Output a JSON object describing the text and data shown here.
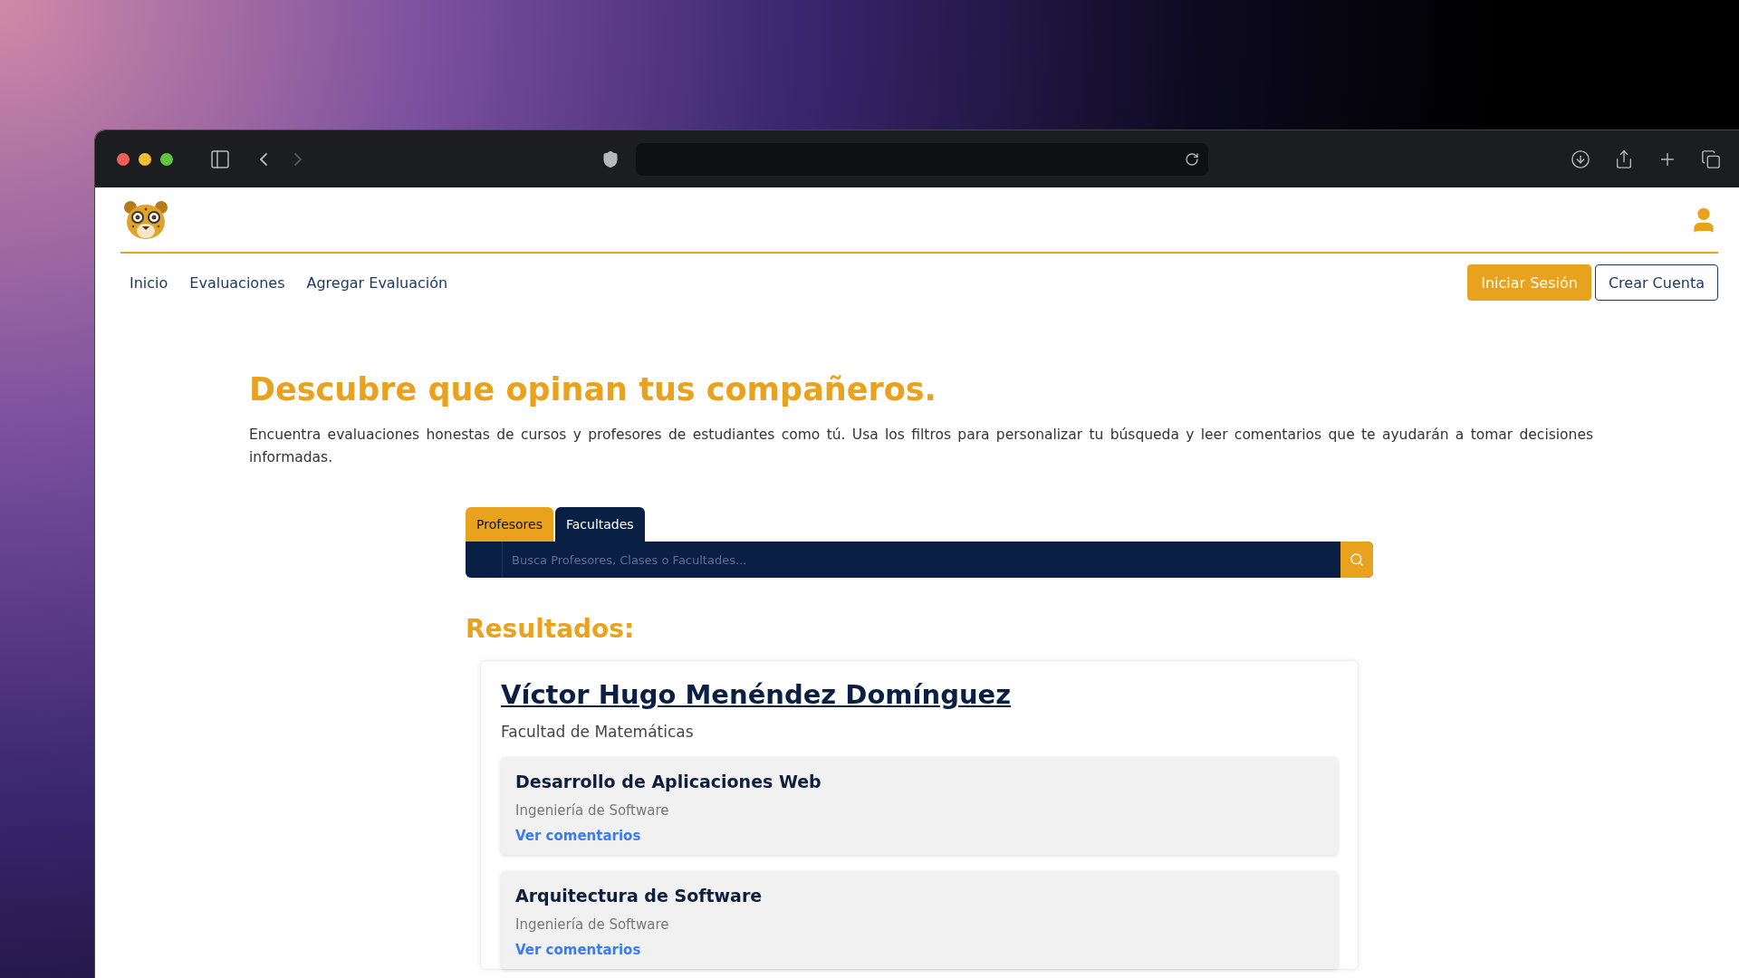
{
  "nav": {
    "links": [
      {
        "label": "Inicio"
      },
      {
        "label": "Evaluaciones"
      },
      {
        "label": "Agregar Evaluación"
      }
    ],
    "buttons": [
      {
        "label": "Iniciar Sesión",
        "kind": "primary"
      },
      {
        "label": "Crear Cuenta",
        "kind": "outline"
      }
    ]
  },
  "hero": {
    "title": "Descubre que opinan tus compañeros.",
    "description": "Encuentra evaluaciones honestas de cursos y profesores de estudiantes como tú. Usa los filtros para personalizar tu búsqueda y leer comentarios que te ayudarán a tomar decisiones informadas."
  },
  "search": {
    "tabs": [
      {
        "label": "Profesores",
        "selected": true
      },
      {
        "label": "Facultades",
        "selected": false
      }
    ],
    "placeholder": "Busca Profesores, Clases o Facultades..."
  },
  "results": {
    "heading": "Resultados:",
    "items": [
      {
        "name": "Víctor Hugo Menéndez Domínguez",
        "faculty": "Facultad de Matemáticas",
        "courses": [
          {
            "title": "Desarrollo de Aplicaciones Web",
            "program": "Ingeniería de Software",
            "link": "Ver comentarios"
          },
          {
            "title": "Arquitectura de Software",
            "program": "Ingeniería de Software",
            "link": "Ver comentarios"
          }
        ]
      }
    ]
  }
}
